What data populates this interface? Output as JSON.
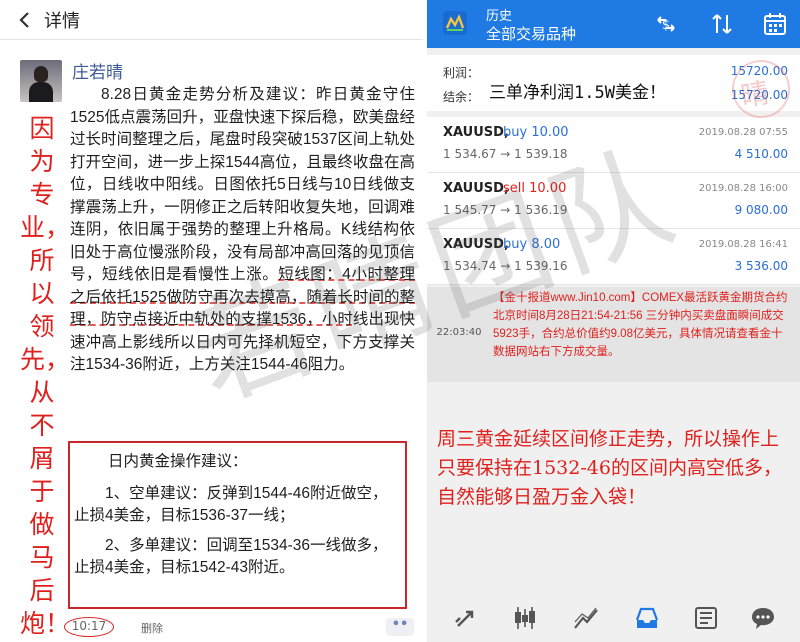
{
  "left": {
    "header_title": "详情",
    "author_name": "庄若晴",
    "side_note": "因为专业，所以领先，从不屑于做马后炮！",
    "post_text_plain": "8.28日黄金走势分析及建议：昨日黄金守住1525低点震荡回升，亚盘快速下探后稳，欧美盘经过长时间整理之后，尾盘时段突破1537区间上轨处打开空间，进一步上探1544高位，且最终收盘在高位，日线收中阳线。日图依托5日线与10日线做支撑震荡上升，一阴修正之后转阳收复失地，回调难连阴，依旧属于强势的整理上升格局。K线结构依旧处于高位慢涨阶段，没有局部冲高回落的见顶信号，短线依旧是看慢性上涨。",
    "post_text_underlined": "短线图：4小时整理之后依托1525做防守再次去摸高，随着长时间的整理，防守点接近中轨处的支撑1536，小时",
    "post_text_tail": "线出现快速冲高上影线所以日内可先择机短空，下方支撑关注1534-36附近，上方关注1544-46阻力。",
    "box_title": "日内黄金操作建议：",
    "box_item1": "1、空单建议：反弹到1544-46附近做空，止损4美金，目标1536-37一线；",
    "box_item2": "2、多单建议：回调至1534-36一线做多，止损4美金，目标1542-43附近。",
    "time": "10:17",
    "delete_label": "删除",
    "more_label": "••"
  },
  "right": {
    "header_line1": "历史",
    "header_line2": "全部交易品种",
    "summary_profit_label": "利润：",
    "summary_profit_value": "15720.00",
    "summary_balance_label": "结余：",
    "summary_balance_value": "15720.00",
    "overlay_text": "三单净利润1.5W美金！",
    "trades": [
      {
        "symbol": "XAUUSD,",
        "side": "buy 10.00",
        "side_color": "#2a6fd6",
        "prices": "1 534.67 → 1 539.18",
        "date": "2019.08.28 07:55",
        "profit": "4 510.00"
      },
      {
        "symbol": "XAUUSD,",
        "side": "sell 10.00",
        "side_color": "#e0201d",
        "prices": "1 545.77 → 1 536.19",
        "date": "2019.08.28 16:00",
        "profit": "9 080.00"
      },
      {
        "symbol": "XAUUSD,",
        "side": "buy 8.00",
        "side_color": "#2a6fd6",
        "prices": "1 534.74 → 1 539.16",
        "date": "2019.08.28 16:41",
        "profit": "3 536.00"
      }
    ],
    "news_time": "22:03:40",
    "news_text": "【金十报道www.Jin10.com】COMEX最活跃黄金期货合约北京时间8月28日21:54-21:56 三分钟内买卖盘面瞬间成交5923手，合约总价值约9.08亿美元，具体情况请查看金十数据网站右下方成交量。",
    "note_text": "周三黄金延续区间修正走势，所以操作上只要保持在1532-46的区间内高空低多，自然能够日盈万金入袋！",
    "watermark": "若晴团队",
    "seal_char": "晴"
  }
}
